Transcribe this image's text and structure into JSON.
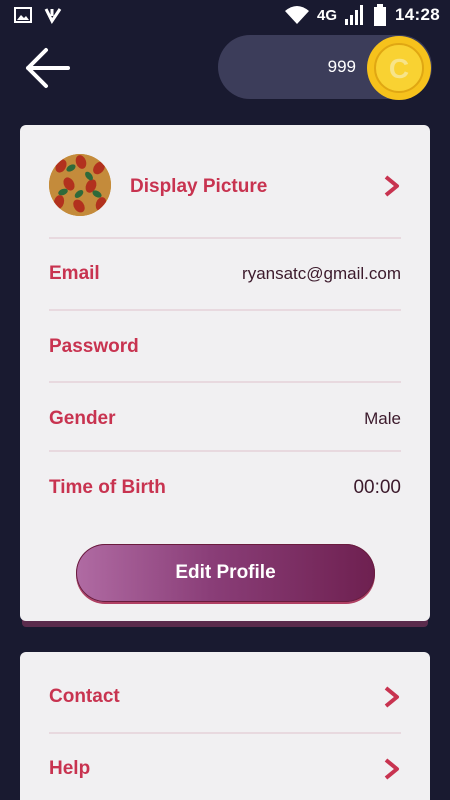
{
  "status_bar": {
    "network": "4G",
    "time": "14:28"
  },
  "header": {
    "coin_count": "999",
    "coin_letter": "C"
  },
  "profile": {
    "display_picture_label": "Display Picture",
    "email_label": "Email",
    "email_value": "ryansatc@gmail.com",
    "password_label": "Password",
    "gender_label": "Gender",
    "gender_value": "Male",
    "birth_label": "Time of Birth",
    "birth_value": "00:00",
    "edit_button": "Edit Profile"
  },
  "menu": {
    "items": [
      {
        "label": "Contact"
      },
      {
        "label": "Help"
      }
    ]
  },
  "colors": {
    "background": "#191a30",
    "accent": "#c83350",
    "card": "#f1f0f2",
    "coin": "#f6c21c"
  },
  "icons": [
    "image-icon",
    "download-icon",
    "wifi-icon",
    "signal-icon",
    "battery-icon",
    "back-arrow-icon",
    "coin-icon",
    "chevron-right-icon"
  ]
}
